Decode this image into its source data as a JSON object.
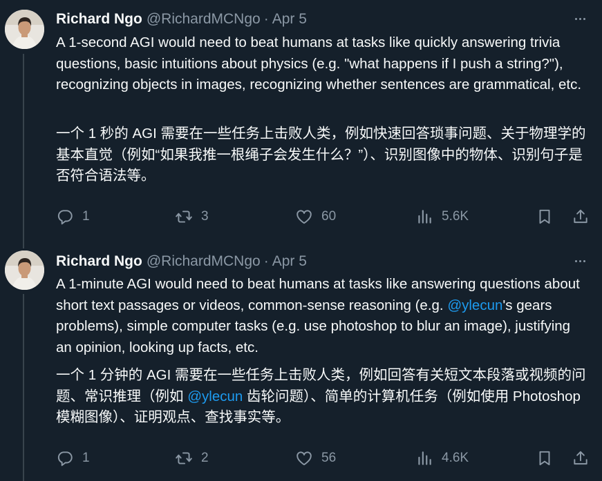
{
  "tweets": [
    {
      "author_name": "Richard Ngo",
      "handle": "@RichardMCNgo",
      "separator": "·",
      "date": "Apr 5",
      "text_en": "A 1-second AGI would need to beat humans at tasks like quickly answering trivia questions, basic intuitions about physics (e.g. \"what happens if I push a string?\"), recognizing objects in images, recognizing whether sentences are grammatical, etc.",
      "text_zh": "一个 1 秒的 AGI 需要在一些任务上击败人类，例如快速回答琐事问题、关于物理学的基本直觉（例如“如果我推一根绳子会发生什么？”）、识别图像中的物体、识别句子是否符合语法等。",
      "replies": "1",
      "reposts": "3",
      "likes": "60",
      "views": "5.6K"
    },
    {
      "author_name": "Richard Ngo",
      "handle": "@RichardMCNgo",
      "separator": "·",
      "date": "Apr 5",
      "text_en_1": "A 1-minute AGI would need to beat humans at tasks like answering questions about short text passages or videos, common-sense reasoning (e.g. ",
      "mention_en": "@ylecun",
      "text_en_2": "'s gears problems), simple computer tasks (e.g. use photoshop to blur an image), justifying an opinion, looking up facts, etc.",
      "text_zh_1": "一个 1 分钟的 AGI 需要在一些任务上击败人类，例如回答有关短文本段落或视频的问题、常识推理（例如 ",
      "mention_zh": "@ylecun",
      "text_zh_2": " 齿轮问题）、简单的计算机任务（例如使用 Photoshop 模糊图像）、证明观点、查找事实等。",
      "replies": "1",
      "reposts": "2",
      "likes": "56",
      "views": "4.6K"
    }
  ],
  "icons": {
    "reply": "reply-icon",
    "repost": "repost-icon",
    "like": "heart-icon",
    "views": "views-icon",
    "bookmark": "bookmark-icon",
    "share": "share-icon",
    "more": "more-icon"
  },
  "colors": {
    "background": "#15202b",
    "text": "#f7f9f9",
    "secondary": "#8b98a5",
    "link": "#1d9bf0",
    "thread_line": "#38444d"
  }
}
